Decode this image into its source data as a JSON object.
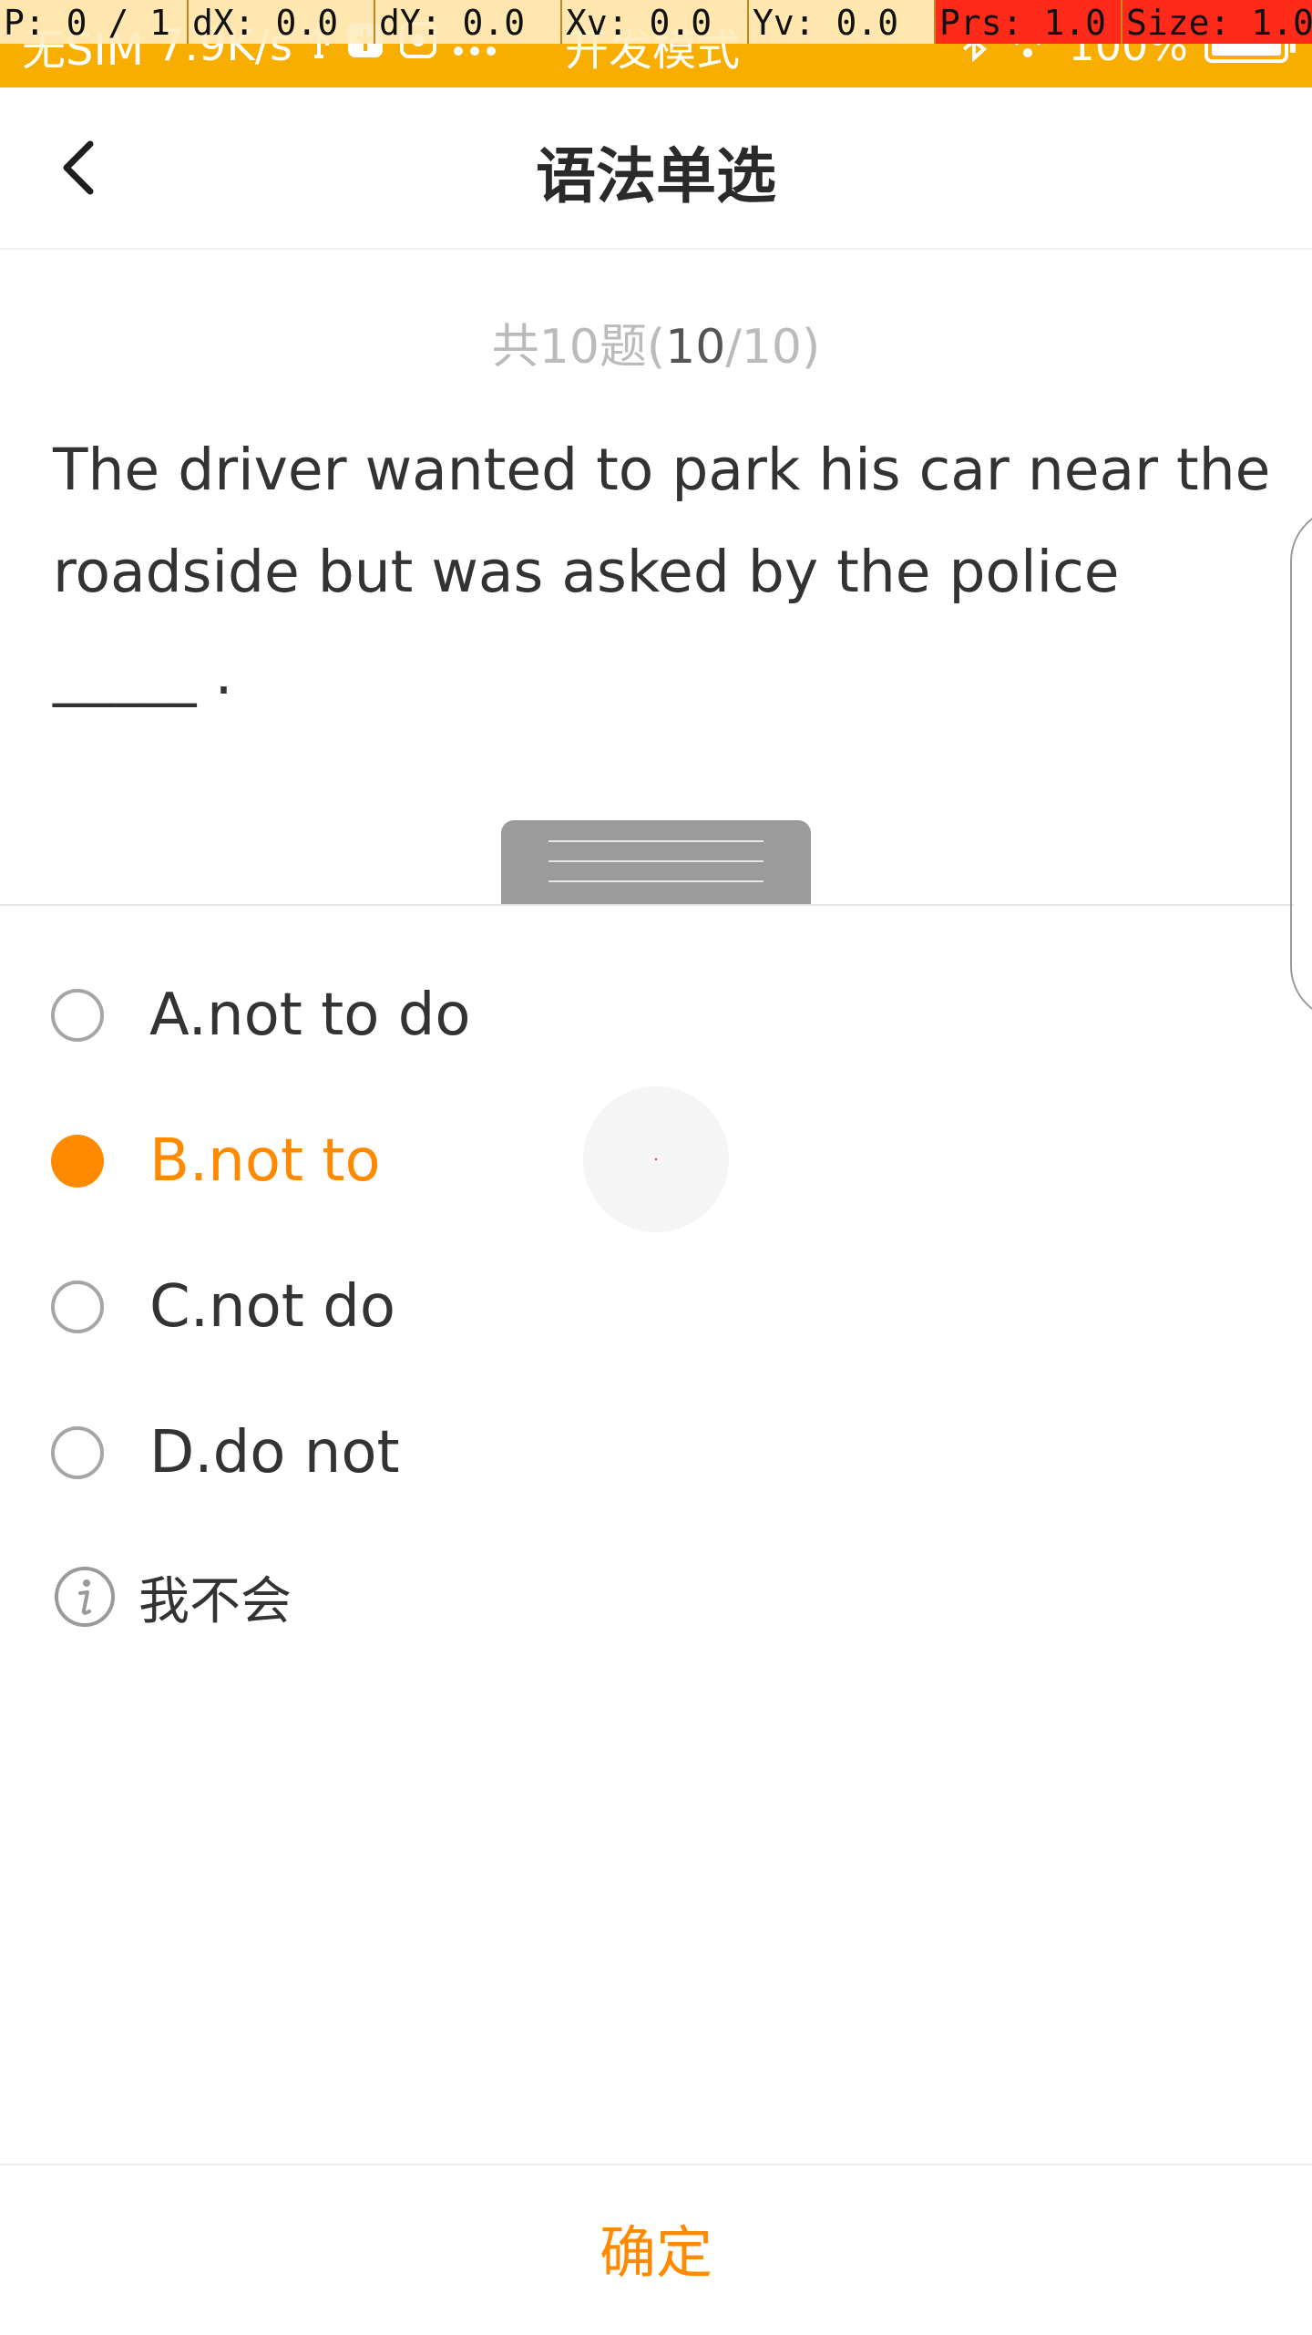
{
  "status_bar": {
    "carrier": "无SIM",
    "speed": "7.9K/s",
    "mode": "开发模式",
    "battery": "100%"
  },
  "dev_overlay": {
    "p": "P: 0 / 1",
    "dx": "dX: 0.0",
    "dy": "dY: 0.0",
    "xv": "Xv: 0.0",
    "yv": "Yv: 0.0",
    "prs": "Prs: 1.0",
    "size": "Size: 1.0"
  },
  "header": {
    "title": "语法单选"
  },
  "progress": {
    "prefix": "共10题(",
    "current": "10",
    "suffix": "/10)"
  },
  "question": {
    "text": "The driver wanted to park his car near the roadside but was asked by the police _____ ."
  },
  "options": [
    {
      "label": "A.not to do",
      "selected": false
    },
    {
      "label": "B.not to",
      "selected": true
    },
    {
      "label": "C.not do",
      "selected": false
    },
    {
      "label": "D.do not",
      "selected": false
    }
  ],
  "dont_know": {
    "label": "我不会"
  },
  "footer": {
    "confirm_label": "确定"
  },
  "colors": {
    "status_bar": "#f8ae00",
    "accent": "#ff8a00"
  }
}
